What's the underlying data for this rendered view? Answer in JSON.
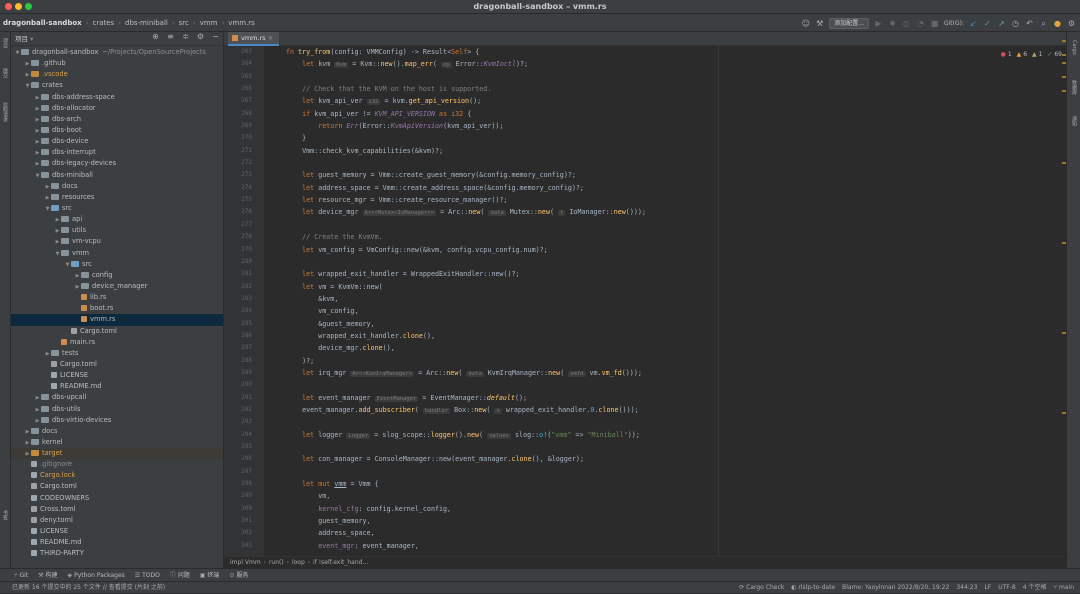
{
  "window": {
    "title": "dragonball-sandbox – vmm.rs"
  },
  "breadcrumbs": [
    "dragonball-sandbox",
    "crates",
    "dbs-miniball",
    "src",
    "vmm",
    "vmm.rs"
  ],
  "toolbar": {
    "add_config": "添加配置...",
    "git_label": "Git(G):"
  },
  "left_tools": [
    "项目",
    "提交",
    "拉取请求",
    "书签"
  ],
  "right_tools": [
    "Cargo",
    "数据库",
    "通知"
  ],
  "project": {
    "title": "项目",
    "tree": [
      {
        "label": "dragonball-sandbox",
        "suffix": "~/Projects/OpenSourceProjects",
        "depth": 0,
        "type": "folder",
        "open": true
      },
      {
        "label": ".github",
        "depth": 1,
        "type": "folder"
      },
      {
        "label": ".vscode",
        "depth": 1,
        "type": "folder",
        "color": "orange"
      },
      {
        "label": "crates",
        "depth": 1,
        "type": "folder",
        "open": true
      },
      {
        "label": "dbs-address-space",
        "depth": 2,
        "type": "folder"
      },
      {
        "label": "dbs-allocator",
        "depth": 2,
        "type": "folder"
      },
      {
        "label": "dbs-arch",
        "depth": 2,
        "type": "folder"
      },
      {
        "label": "dbs-boot",
        "depth": 2,
        "type": "folder"
      },
      {
        "label": "dbs-device",
        "depth": 2,
        "type": "folder"
      },
      {
        "label": "dbs-interrupt",
        "depth": 2,
        "type": "folder"
      },
      {
        "label": "dbs-legacy-devices",
        "depth": 2,
        "type": "folder"
      },
      {
        "label": "dbs-miniball",
        "depth": 2,
        "type": "folder",
        "open": true
      },
      {
        "label": "docs",
        "depth": 3,
        "type": "folder"
      },
      {
        "label": "resources",
        "depth": 3,
        "type": "folder"
      },
      {
        "label": "src",
        "depth": 3,
        "type": "folder",
        "open": true,
        "color": "blue"
      },
      {
        "label": "api",
        "depth": 4,
        "type": "folder"
      },
      {
        "label": "utils",
        "depth": 4,
        "type": "folder"
      },
      {
        "label": "vm-vcpu",
        "depth": 4,
        "type": "folder"
      },
      {
        "label": "vmm",
        "depth": 4,
        "type": "folder",
        "open": true
      },
      {
        "label": "src",
        "depth": 5,
        "type": "folder",
        "open": true,
        "color": "blue"
      },
      {
        "label": "config",
        "depth": 6,
        "type": "folder"
      },
      {
        "label": "device_manager",
        "depth": 6,
        "type": "folder"
      },
      {
        "label": "lib.rs",
        "depth": 6,
        "type": "rs"
      },
      {
        "label": "boot.rs",
        "depth": 6,
        "type": "rs"
      },
      {
        "label": "vmm.rs",
        "depth": 6,
        "type": "rs",
        "selected": true
      },
      {
        "label": "Cargo.toml",
        "depth": 5,
        "type": "toml"
      },
      {
        "label": "main.rs",
        "depth": 4,
        "type": "rs"
      },
      {
        "label": "tests",
        "depth": 3,
        "type": "folder"
      },
      {
        "label": "Cargo.toml",
        "depth": 3,
        "type": "toml"
      },
      {
        "label": "LICENSE",
        "depth": 3,
        "type": "file"
      },
      {
        "label": "README.md",
        "depth": 3,
        "type": "file"
      },
      {
        "label": "dbs-upcall",
        "depth": 2,
        "type": "folder"
      },
      {
        "label": "dbs-utils",
        "depth": 2,
        "type": "folder"
      },
      {
        "label": "dbs-virtio-devices",
        "depth": 2,
        "type": "folder"
      },
      {
        "label": "docs",
        "depth": 1,
        "type": "folder"
      },
      {
        "label": "kernel",
        "depth": 1,
        "type": "folder"
      },
      {
        "label": "target",
        "depth": 1,
        "type": "folder",
        "color": "orange",
        "target": true
      },
      {
        "label": ".gitignore",
        "depth": 1,
        "type": "file",
        "gray": true
      },
      {
        "label": "Cargo.lock",
        "depth": 1,
        "type": "file",
        "orange": true
      },
      {
        "label": "Cargo.toml",
        "depth": 1,
        "type": "toml"
      },
      {
        "label": "CODEOWNERS",
        "depth": 1,
        "type": "file"
      },
      {
        "label": "Cross.toml",
        "depth": 1,
        "type": "toml"
      },
      {
        "label": "deny.toml",
        "depth": 1,
        "type": "toml"
      },
      {
        "label": "LICENSE",
        "depth": 1,
        "type": "file"
      },
      {
        "label": "README.md",
        "depth": 1,
        "type": "file"
      },
      {
        "label": "THIRD-PARTY",
        "depth": 1,
        "type": "file"
      }
    ]
  },
  "editor": {
    "tab": "vmm.rs",
    "inspections": {
      "errors": "1",
      "warnings": "6",
      "weak": "1",
      "ok": "69"
    },
    "line_numbers": [
      "263",
      "264",
      "265",
      "266",
      "267",
      "268",
      "269",
      "270",
      "271",
      "272",
      "273",
      "274",
      "275",
      "276",
      "277",
      "278",
      "279",
      "280",
      "281",
      "282",
      "283",
      "284",
      "285",
      "286",
      "287",
      "288",
      "289",
      "290",
      "291",
      "292",
      "293",
      "294",
      "295",
      "296",
      "297",
      "298",
      "299",
      "300",
      "301",
      "302",
      "303"
    ],
    "breadcrumb_bar": [
      "impl Vmm",
      "run()",
      "loop",
      "if !self.exit_hand..."
    ]
  },
  "bottom_tools": [
    "Git",
    "构建",
    "Python Packages",
    "TODO",
    "问题",
    "终端",
    "服务"
  ],
  "status": {
    "message": "已更新 16 个提交中的 25 个文件 // 查看提交 (片刻 之前)",
    "items": [
      "Cargo Check",
      "rlslp-to-date",
      "Blame: Yaoyinnan 2022/8/20, 19:22",
      "344:23",
      "LF",
      "UTF-8",
      "4 个空格",
      "main"
    ]
  }
}
